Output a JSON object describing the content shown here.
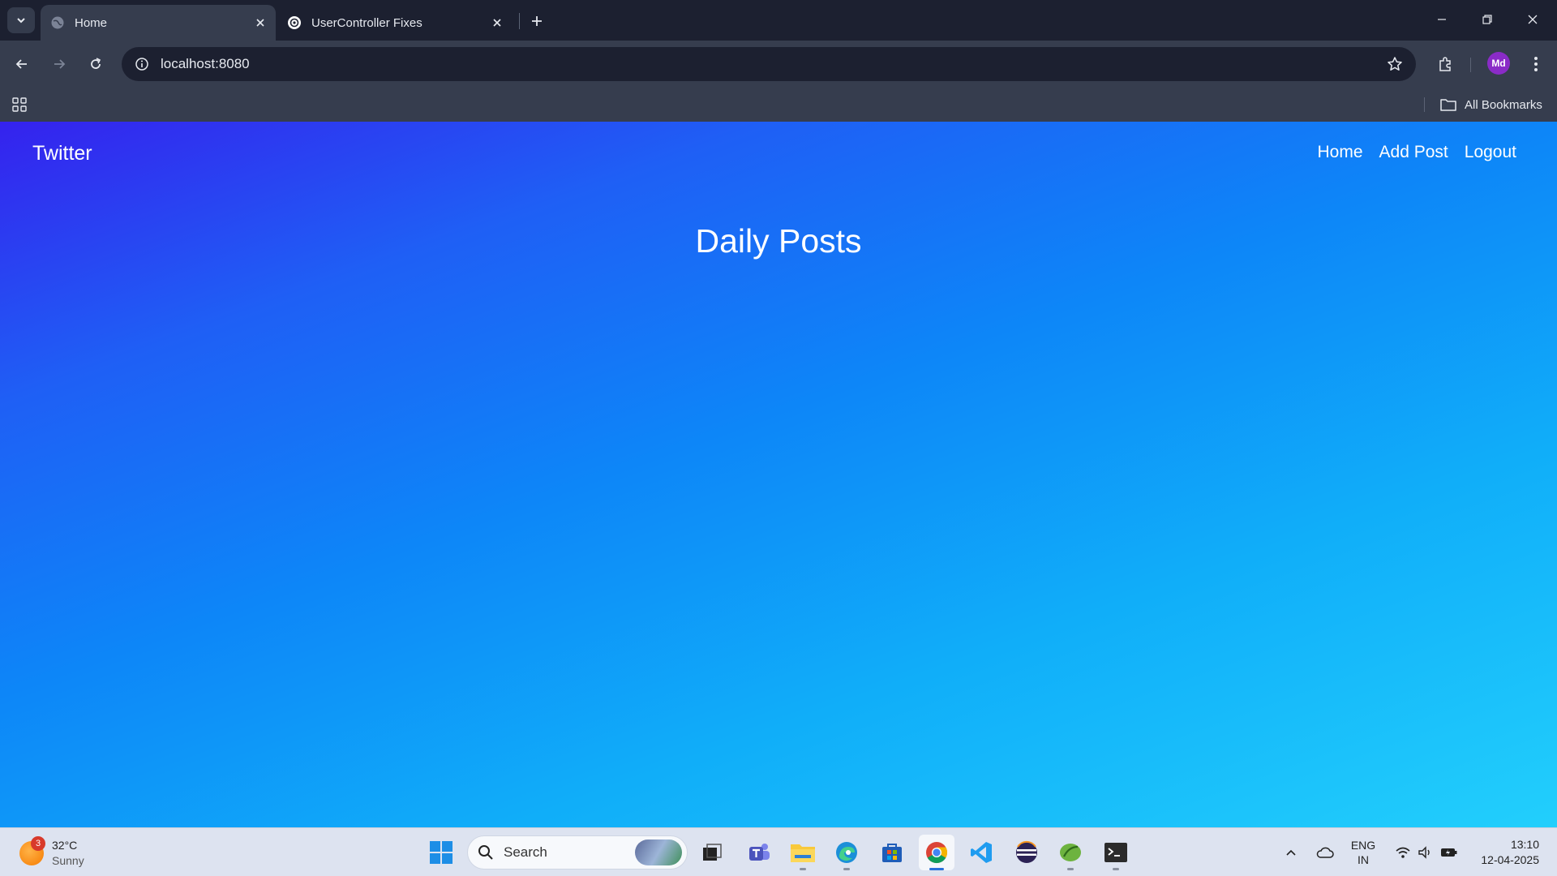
{
  "browser": {
    "tabs": [
      {
        "title": "Home",
        "active": true
      },
      {
        "title": "UserController Fixes",
        "active": false
      }
    ],
    "url": "localhost:8080",
    "profile_initials": "Md",
    "bookmarks_label": "All Bookmarks"
  },
  "site": {
    "brand": "Twitter",
    "nav": [
      "Home",
      "Add Post",
      "Logout"
    ],
    "heading": "Daily Posts"
  },
  "taskbar": {
    "weather": {
      "temp": "32°C",
      "condition": "Sunny",
      "badge": "3"
    },
    "search_label": "Search",
    "lang": {
      "line1": "ENG",
      "line2": "IN"
    },
    "time": "13:10",
    "date": "12-04-2025"
  },
  "colors": {
    "gradient_top": "#3522ee",
    "gradient_mid": "#0d86f8",
    "gradient_bottom": "#22cffc",
    "chrome_dark": "#1c2030",
    "chrome_toolbar": "#363d4e"
  }
}
